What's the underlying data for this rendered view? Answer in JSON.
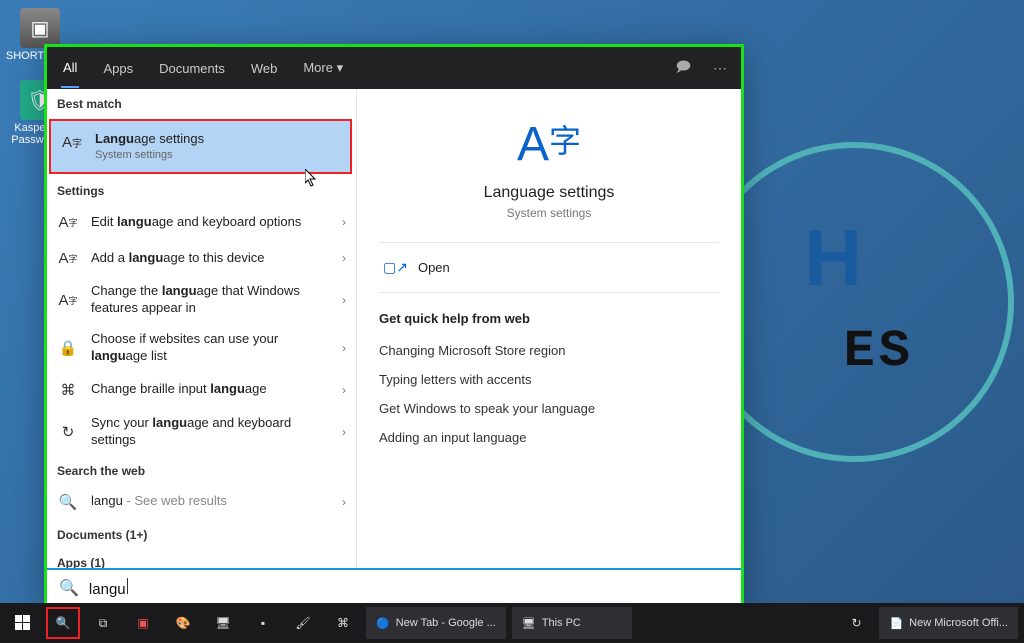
{
  "desktop": {
    "icons": {
      "shortcuts": "SHORTCUTS",
      "kaspersky": "Kaspersky Password..."
    }
  },
  "watermark": {
    "letters1": "H",
    "letters2": "ES"
  },
  "search": {
    "tabs": {
      "all": "All",
      "apps": "Apps",
      "documents": "Documents",
      "web": "Web",
      "more": "More"
    },
    "section_best": "Best match",
    "best": {
      "title": "Language settings",
      "sub": "System settings"
    },
    "section_settings": "Settings",
    "settings": [
      {
        "pre": "Edit ",
        "bold": "langu",
        "post": "age and keyboard options"
      },
      {
        "pre": "Add a ",
        "bold": "langu",
        "post": "age to this device"
      },
      {
        "pre": "Change the ",
        "bold": "langu",
        "post": "age that Windows features appear in"
      },
      {
        "pre": "Choose if websites can use your ",
        "bold": "langu",
        "post": "age list"
      },
      {
        "pre": "Change braille input ",
        "bold": "langu",
        "post": "age"
      },
      {
        "pre": "Sync your ",
        "bold": "langu",
        "post": "age and keyboard settings"
      }
    ],
    "section_web": "Search the web",
    "web_result": {
      "term": "langu",
      "hint": " - See web results"
    },
    "section_docs": "Documents (1+)",
    "section_apps": "Apps (1)",
    "detail": {
      "title": "Language settings",
      "sub": "System settings",
      "open": "Open",
      "quick_title": "Get quick help from web",
      "quick_links": [
        "Changing Microsoft Store region",
        "Typing letters with accents",
        "Get Windows to speak your language",
        "Adding an input language"
      ]
    },
    "query": "langu"
  },
  "taskbar": {
    "apps": [
      "New Tab - Google ...",
      "This PC",
      "New Microsoft Offi..."
    ]
  }
}
